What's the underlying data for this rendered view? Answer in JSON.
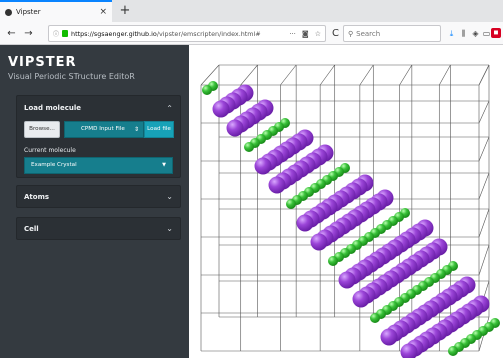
{
  "browser": {
    "tab_title": "Vipster",
    "new_tab": "+",
    "url_host": "https://sgsaenger.github.io",
    "url_path": "/vipster/emscripten/index.html#",
    "search_placeholder": "Search",
    "url_menu": "···",
    "nav_back": "←",
    "nav_forward": "→",
    "nav_reload": "C",
    "nav_home": "⌂"
  },
  "app": {
    "title": "VIPSTER",
    "subtitle": "Visual Periodic STructure EditoR"
  },
  "panels": {
    "load": {
      "label": "Load molecule",
      "browse_label": "Browse...",
      "format_value": "CPMD Input File",
      "load_label": "Load file",
      "current_label": "Current molecule",
      "current_value": "Example Crystal"
    },
    "atoms": {
      "label": "Atoms"
    },
    "cell": {
      "label": "Cell"
    }
  },
  "viewer": {
    "colors": {
      "purple": "#9b45d8",
      "purple_dark": "#6a1fa8",
      "green": "#3ac23a",
      "green_dark": "#178a17",
      "cell_lines": "#555555"
    }
  }
}
